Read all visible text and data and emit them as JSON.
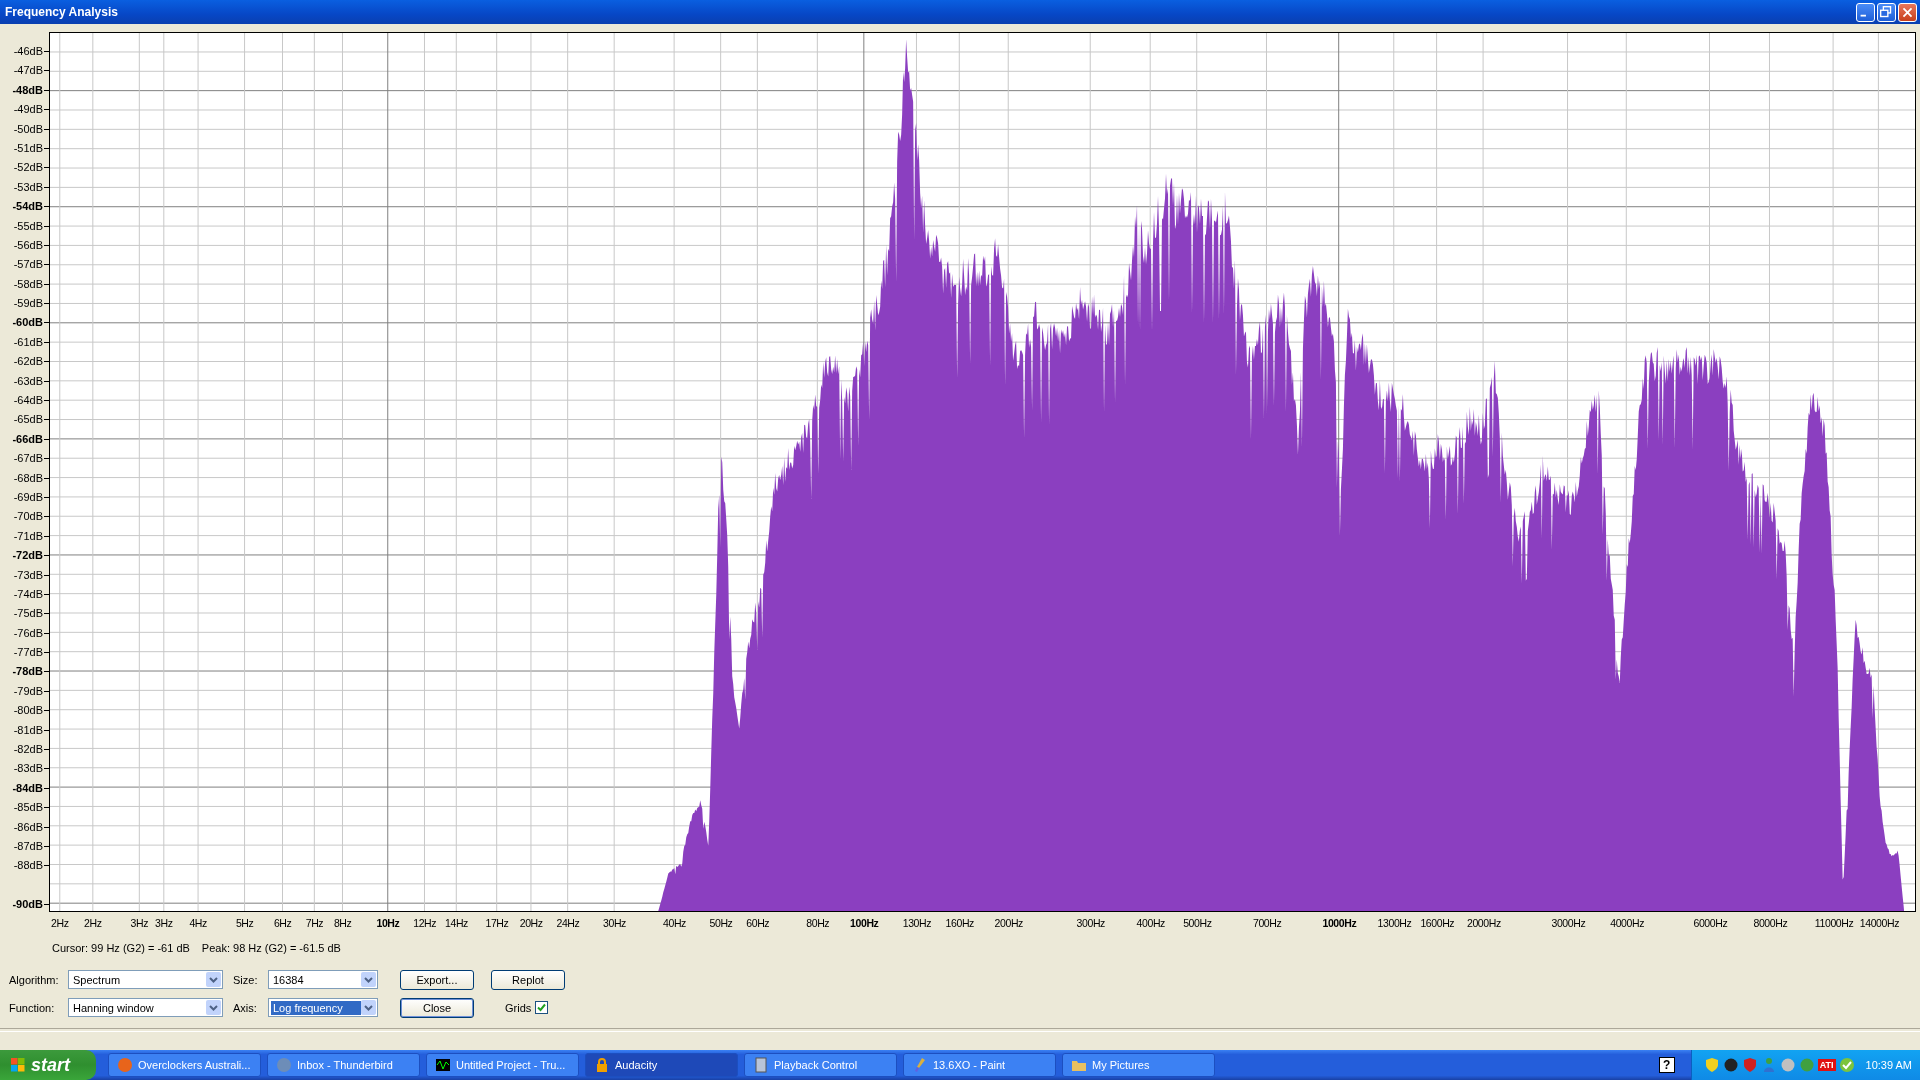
{
  "window": {
    "title": "Frequency Analysis"
  },
  "plot": {
    "y_labels": [
      {
        "text": "-46dB",
        "major": false
      },
      {
        "text": "-47dB",
        "major": false
      },
      {
        "text": "-48dB",
        "major": true
      },
      {
        "text": "-49dB",
        "major": false
      },
      {
        "text": "-50dB",
        "major": false
      },
      {
        "text": "-51dB",
        "major": false
      },
      {
        "text": "-52dB",
        "major": false
      },
      {
        "text": "-53dB",
        "major": false
      },
      {
        "text": "-54dB",
        "major": true
      },
      {
        "text": "-55dB",
        "major": false
      },
      {
        "text": "-56dB",
        "major": false
      },
      {
        "text": "-57dB",
        "major": false
      },
      {
        "text": "-58dB",
        "major": false
      },
      {
        "text": "-59dB",
        "major": false
      },
      {
        "text": "-60dB",
        "major": true
      },
      {
        "text": "-61dB",
        "major": false
      },
      {
        "text": "-62dB",
        "major": false
      },
      {
        "text": "-63dB",
        "major": false
      },
      {
        "text": "-64dB",
        "major": false
      },
      {
        "text": "-65dB",
        "major": false
      },
      {
        "text": "-66dB",
        "major": true
      },
      {
        "text": "-67dB",
        "major": false
      },
      {
        "text": "-68dB",
        "major": false
      },
      {
        "text": "-69dB",
        "major": false
      },
      {
        "text": "-70dB",
        "major": false
      },
      {
        "text": "-71dB",
        "major": false
      },
      {
        "text": "-72dB",
        "major": true
      },
      {
        "text": "-73dB",
        "major": false
      },
      {
        "text": "-74dB",
        "major": false
      },
      {
        "text": "-75dB",
        "major": false
      },
      {
        "text": "-76dB",
        "major": false
      },
      {
        "text": "-77dB",
        "major": false
      },
      {
        "text": "-78dB",
        "major": true
      },
      {
        "text": "-79dB",
        "major": false
      },
      {
        "text": "-80dB",
        "major": false
      },
      {
        "text": "-81dB",
        "major": false
      },
      {
        "text": "-82dB",
        "major": false
      },
      {
        "text": "-83dB",
        "major": false
      },
      {
        "text": "-84dB",
        "major": true
      },
      {
        "text": "-85dB",
        "major": false
      },
      {
        "text": "-86dB",
        "major": false
      },
      {
        "text": "-87dB",
        "major": false
      },
      {
        "text": "-88dB",
        "major": false
      },
      {
        "text": "-90dB",
        "major": true
      }
    ],
    "x_labels": [
      {
        "text": "2Hz",
        "major": false
      },
      {
        "text": "2Hz",
        "major": false
      },
      {
        "text": "3Hz",
        "major": false
      },
      {
        "text": "3Hz",
        "major": false
      },
      {
        "text": "4Hz",
        "major": false
      },
      {
        "text": "5Hz",
        "major": false
      },
      {
        "text": "6Hz",
        "major": false
      },
      {
        "text": "7Hz",
        "major": false
      },
      {
        "text": "8Hz",
        "major": false
      },
      {
        "text": "10Hz",
        "major": true
      },
      {
        "text": "12Hz",
        "major": false
      },
      {
        "text": "14Hz",
        "major": false
      },
      {
        "text": "17Hz",
        "major": false
      },
      {
        "text": "20Hz",
        "major": false
      },
      {
        "text": "24Hz",
        "major": false
      },
      {
        "text": "30Hz",
        "major": false
      },
      {
        "text": "40Hz",
        "major": false
      },
      {
        "text": "50Hz",
        "major": false
      },
      {
        "text": "60Hz",
        "major": false
      },
      {
        "text": "80Hz",
        "major": false
      },
      {
        "text": "100Hz",
        "major": true
      },
      {
        "text": "130Hz",
        "major": false
      },
      {
        "text": "160Hz",
        "major": false
      },
      {
        "text": "200Hz",
        "major": false
      },
      {
        "text": "300Hz",
        "major": false
      },
      {
        "text": "400Hz",
        "major": false
      },
      {
        "text": "500Hz",
        "major": false
      },
      {
        "text": "700Hz",
        "major": false
      },
      {
        "text": "1000Hz",
        "major": true
      },
      {
        "text": "1300Hz",
        "major": false
      },
      {
        "text": "1600Hz",
        "major": false
      },
      {
        "text": "2000Hz",
        "major": false
      },
      {
        "text": "3000Hz",
        "major": false
      },
      {
        "text": "4000Hz",
        "major": false
      },
      {
        "text": "6000Hz",
        "major": false
      },
      {
        "text": "8000Hz",
        "major": false
      },
      {
        "text": "11000Hz",
        "major": false
      },
      {
        "text": "14000Hz",
        "major": false
      }
    ]
  },
  "status": {
    "cursor": "Cursor: 99 Hz (G2) = -61 dB",
    "peak": "Peak: 98 Hz (G2) = -61.5 dB"
  },
  "controls": {
    "algorithm": {
      "label": "Algorithm:",
      "value": "Spectrum"
    },
    "size": {
      "label": "Size:",
      "value": "16384"
    },
    "function": {
      "label": "Function:",
      "value": "Hanning window"
    },
    "axis": {
      "label": "Axis:",
      "value": "Log frequency",
      "highlighted": true
    },
    "buttons": [
      {
        "label": "Export...",
        "default": false
      },
      {
        "label": "Replot",
        "default": false
      },
      {
        "label": "Close",
        "default": true
      }
    ],
    "grids": {
      "label": "Grids",
      "checked": true
    }
  },
  "taskbar": {
    "start": "start",
    "tasks": [
      {
        "label": "Overclockers Australi...",
        "selected": false
      },
      {
        "label": "Inbox - Thunderbird",
        "selected": false
      },
      {
        "label": "Untitled Project - Tru...",
        "selected": false
      },
      {
        "label": "Audacity",
        "selected": true
      },
      {
        "label": "Playback Control",
        "selected": false
      },
      {
        "label": "13.6XO - Paint",
        "selected": false
      },
      {
        "label": "My Pictures",
        "selected": false
      }
    ],
    "help": "?",
    "tray_badge": "ATI",
    "clock": "10:39 AM"
  }
}
